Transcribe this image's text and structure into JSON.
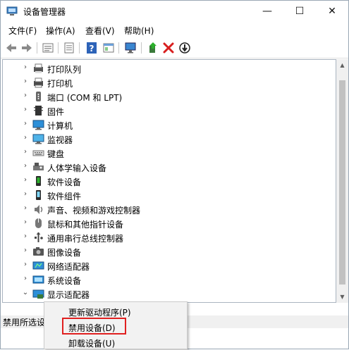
{
  "window": {
    "title": "设备管理器",
    "minimize": "—",
    "maximize": "☐",
    "close": "✕"
  },
  "menu": [
    "文件(F)",
    "操作(A)",
    "查看(V)",
    "帮助(H)"
  ],
  "toolbar": [
    "back-icon",
    "forward-icon",
    "properties-icon",
    "show-hidden-icon",
    "help-icon",
    "view-icon",
    "monitor-scan-icon",
    "update-driver-icon",
    "uninstall-icon",
    "disable-icon"
  ],
  "tree": {
    "items": [
      {
        "label": "打印队列",
        "icon": "printer-queue-icon",
        "expanded": false
      },
      {
        "label": "打印机",
        "icon": "printer-icon",
        "expanded": false
      },
      {
        "label": "端口 (COM 和 LPT)",
        "icon": "port-icon",
        "expanded": false
      },
      {
        "label": "固件",
        "icon": "firmware-icon",
        "expanded": false
      },
      {
        "label": "计算机",
        "icon": "computer-icon",
        "expanded": false
      },
      {
        "label": "监视器",
        "icon": "monitor-icon",
        "expanded": false
      },
      {
        "label": "键盘",
        "icon": "keyboard-icon",
        "expanded": false
      },
      {
        "label": "人体学输入设备",
        "icon": "hid-icon",
        "expanded": false
      },
      {
        "label": "软件设备",
        "icon": "software-device-icon",
        "expanded": false
      },
      {
        "label": "软件组件",
        "icon": "software-component-icon",
        "expanded": false
      },
      {
        "label": "声音、视频和游戏控制器",
        "icon": "sound-icon",
        "expanded": false
      },
      {
        "label": "鼠标和其他指针设备",
        "icon": "mouse-icon",
        "expanded": false
      },
      {
        "label": "通用串行总线控制器",
        "icon": "usb-icon",
        "expanded": false
      },
      {
        "label": "图像设备",
        "icon": "imaging-icon",
        "expanded": false
      },
      {
        "label": "网络适配器",
        "icon": "network-icon",
        "expanded": false
      },
      {
        "label": "系统设备",
        "icon": "system-device-icon",
        "expanded": false
      },
      {
        "label": "显示适配器",
        "icon": "display-adapter-icon",
        "expanded": true
      }
    ]
  },
  "status": {
    "text": "禁用所选设"
  },
  "context_menu": {
    "items": [
      "更新驱动程序(P)",
      "禁用设备(D)",
      "卸载设备(U)"
    ],
    "highlighted_index": 1
  },
  "colors": {
    "accent": "#e02020",
    "border": "#9aa7b5"
  }
}
